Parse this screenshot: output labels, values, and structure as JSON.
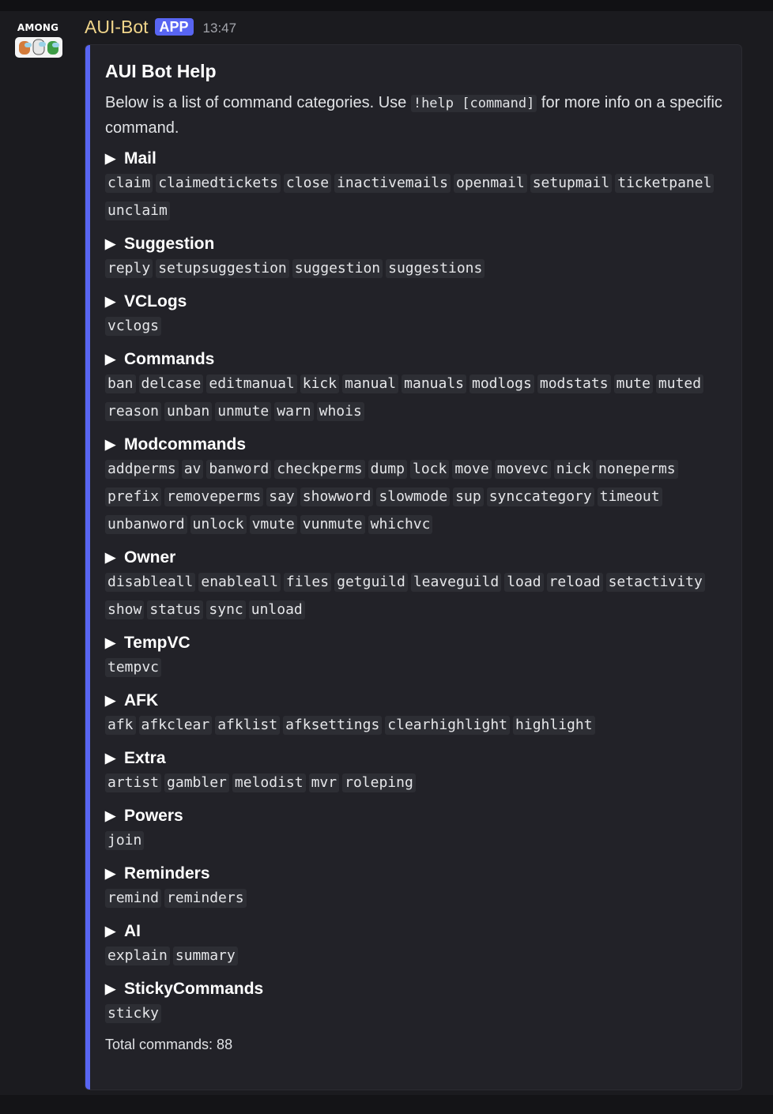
{
  "author": {
    "name": "AUI-Bot",
    "badge": "APP",
    "timestamp": "13:47",
    "avatar_text": "AMONG"
  },
  "embed": {
    "accent_color": "#5865f2",
    "title": "AUI Bot Help",
    "description_before": "Below is a list of command categories. Use ",
    "description_code": "!help [command]",
    "description_after": " for more info on a specific command.",
    "footer": "Total commands: 88",
    "categories": [
      {
        "name": "Mail",
        "commands": [
          "claim",
          "claimedtickets",
          "close",
          "inactivemails",
          "openmail",
          "setupmail",
          "ticketpanel",
          "unclaim"
        ]
      },
      {
        "name": "Suggestion",
        "commands": [
          "reply",
          "setupsuggestion",
          "suggestion",
          "suggestions"
        ]
      },
      {
        "name": "VCLogs",
        "commands": [
          "vclogs"
        ]
      },
      {
        "name": "Commands",
        "commands": [
          "ban",
          "delcase",
          "editmanual",
          "kick",
          "manual",
          "manuals",
          "modlogs",
          "modstats",
          "mute",
          "muted",
          "reason",
          "unban",
          "unmute",
          "warn",
          "whois"
        ]
      },
      {
        "name": "Modcommands",
        "commands": [
          "addperms",
          "av",
          "banword",
          "checkperms",
          "dump",
          "lock",
          "move",
          "movevc",
          "nick",
          "noneperms",
          "prefix",
          "removeperms",
          "say",
          "showword",
          "slowmode",
          "sup",
          "synccategory",
          "timeout",
          "unbanword",
          "unlock",
          "vmute",
          "vunmute",
          "whichvc"
        ]
      },
      {
        "name": "Owner",
        "commands": [
          "disableall",
          "enableall",
          "files",
          "getguild",
          "leaveguild",
          "load",
          "reload",
          "setactivity",
          "show",
          "status",
          "sync",
          "unload"
        ]
      },
      {
        "name": "TempVC",
        "commands": [
          "tempvc"
        ]
      },
      {
        "name": "AFK",
        "commands": [
          "afk",
          "afkclear",
          "afklist",
          "afksettings",
          "clearhighlight",
          "highlight"
        ]
      },
      {
        "name": "Extra",
        "commands": [
          "artist",
          "gambler",
          "melodist",
          "mvr",
          "roleping"
        ]
      },
      {
        "name": "Powers",
        "commands": [
          "join"
        ]
      },
      {
        "name": "Reminders",
        "commands": [
          "remind",
          "reminders"
        ]
      },
      {
        "name": "AI",
        "commands": [
          "explain",
          "summary"
        ]
      },
      {
        "name": "StickyCommands",
        "commands": [
          "sticky"
        ]
      }
    ]
  }
}
